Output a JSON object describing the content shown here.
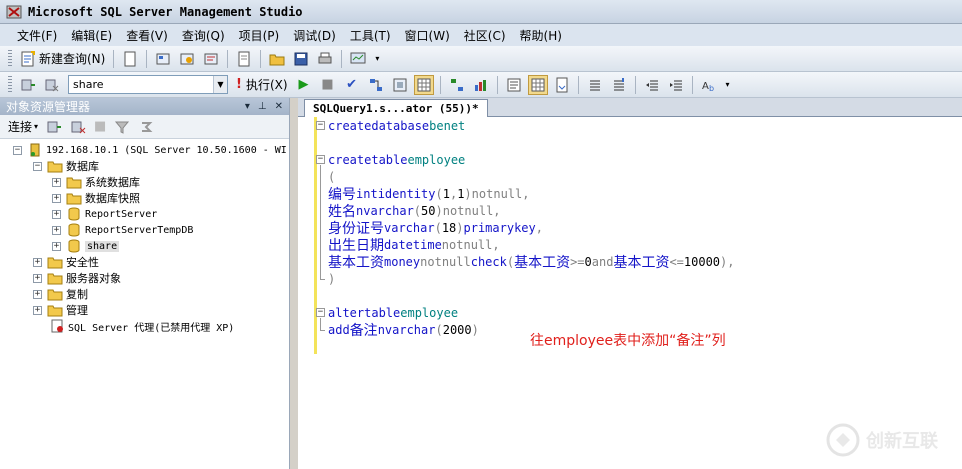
{
  "window": {
    "title": "Microsoft SQL Server Management Studio"
  },
  "menu": [
    "文件(F)",
    "编辑(E)",
    "查看(V)",
    "查询(Q)",
    "项目(P)",
    "调试(D)",
    "工具(T)",
    "窗口(W)",
    "社区(C)",
    "帮助(H)"
  ],
  "toolbar": {
    "new_query_label": "新建查询(N)",
    "database_combo": "share",
    "execute_label": "执行(X)"
  },
  "explorer": {
    "title": "对象资源管理器",
    "connect_label": "连接",
    "server": "192.168.10.1 (SQL Server 10.50.1600 - WI",
    "databases": "数据库",
    "db_children": [
      "系统数据库",
      "数据库快照",
      "ReportServer",
      "ReportServerTempDB",
      "share"
    ],
    "folders": [
      "安全性",
      "服务器对象",
      "复制",
      "管理"
    ],
    "agent": "SQL Server 代理(已禁用代理 XP)"
  },
  "editor": {
    "tab_label": "SQLQuery1.s...ator (55))*",
    "annotation": "往employee表中添加“备注”列"
  },
  "colors": {
    "keyword": "#1414c8",
    "gray": "#808080",
    "ident": "#008080",
    "annotation": "#e0201c"
  },
  "watermark": "创新互联"
}
